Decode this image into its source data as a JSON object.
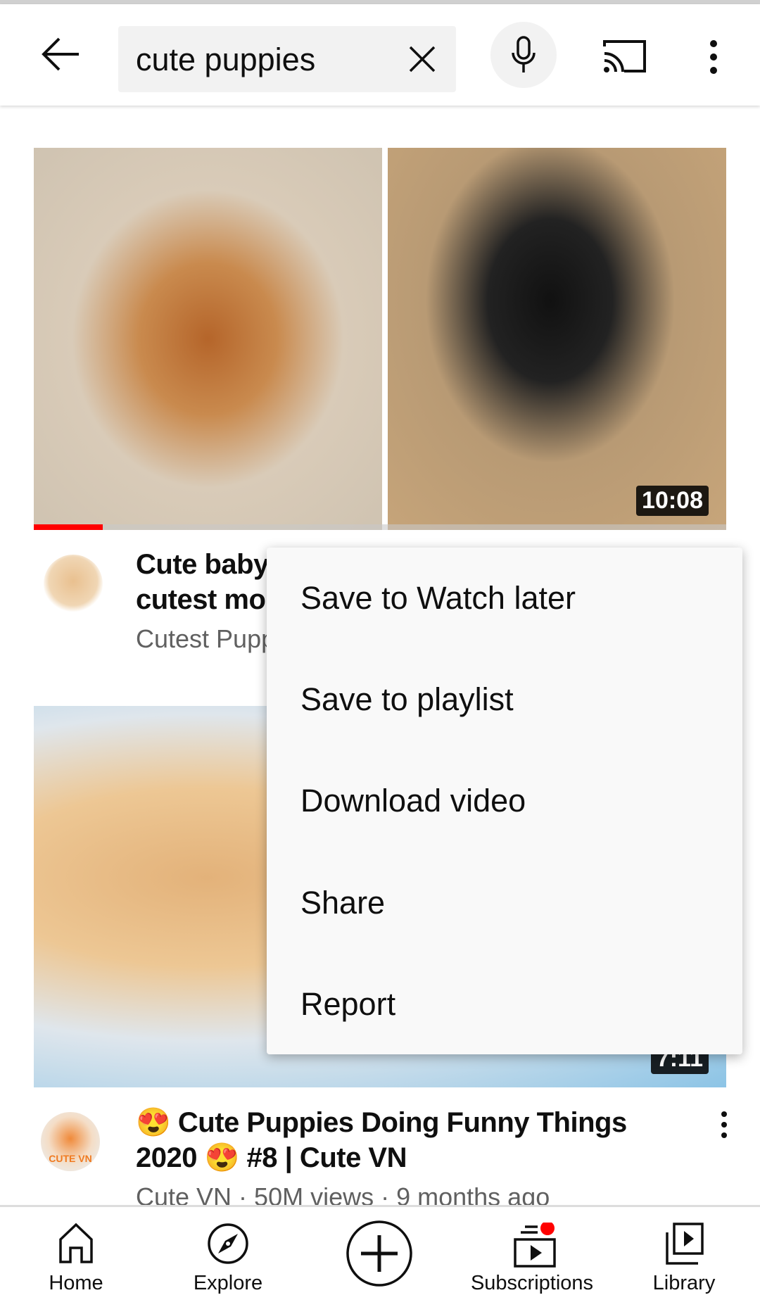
{
  "search": {
    "query": "cute puppies"
  },
  "videos": [
    {
      "title_line1": "Cute baby",
      "title_line2": "cutest mo",
      "channel_meta": "Cutest Pupp",
      "duration": "10:08",
      "watched_progress_percent": 10
    },
    {
      "title_line1": "😍 Cute Puppies Doing Funny Things",
      "title_line2": "2020 😍 #8 | Cute VN",
      "channel_meta": "Cute VN · 50M views · 9 months ago",
      "duration": "7:11",
      "avatar_text": "CUTE VN"
    }
  ],
  "menu": {
    "items": [
      "Save to Watch later",
      "Save to playlist",
      "Download video",
      "Share",
      "Report"
    ]
  },
  "nav": {
    "items": [
      "Home",
      "Explore",
      "",
      "Subscriptions",
      "Library"
    ]
  },
  "colors": {
    "accent": "#ff0000",
    "notification": "#ff0000"
  }
}
